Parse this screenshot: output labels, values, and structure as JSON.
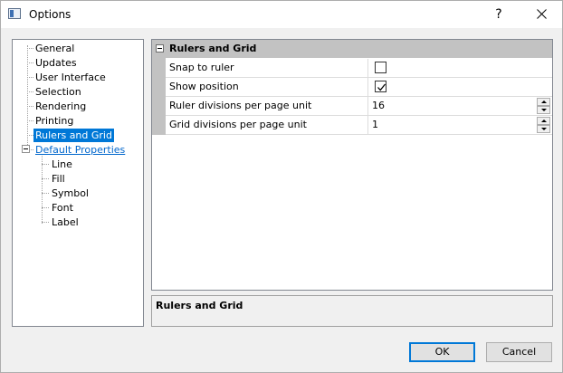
{
  "window": {
    "title": "Options",
    "help_glyph": "?",
    "icon": "app-icon"
  },
  "tree": {
    "items": [
      {
        "label": "General"
      },
      {
        "label": "Updates"
      },
      {
        "label": "User Interface"
      },
      {
        "label": "Selection"
      },
      {
        "label": "Rendering"
      },
      {
        "label": "Printing"
      },
      {
        "label": "Rulers and Grid",
        "selected": true
      },
      {
        "label": "Default Properties",
        "expanded": true
      },
      {
        "label": "Line"
      },
      {
        "label": "Fill"
      },
      {
        "label": "Symbol"
      },
      {
        "label": "Font"
      },
      {
        "label": "Label"
      }
    ]
  },
  "property_grid": {
    "category": "Rulers and Grid",
    "rows": [
      {
        "name": "Snap to ruler",
        "type": "checkbox",
        "checked": false
      },
      {
        "name": "Show position",
        "type": "checkbox",
        "checked": true
      },
      {
        "name": "Ruler divisions per page unit",
        "type": "number",
        "value": "16"
      },
      {
        "name": "Grid divisions per page unit",
        "type": "number",
        "value": "1"
      }
    ]
  },
  "description": {
    "title": "Rulers and Grid"
  },
  "buttons": {
    "ok": "OK",
    "cancel": "Cancel"
  },
  "colors": {
    "selection": "#0078d7",
    "link": "#0066cc",
    "category_header": "#c2c2c2"
  }
}
